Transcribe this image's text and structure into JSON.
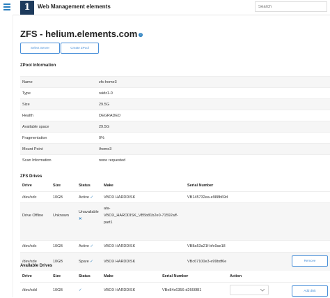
{
  "header": {
    "brand": "Web Management elements",
    "search_placeholder": "Search"
  },
  "page": {
    "title": "ZFS - helium.elements.com"
  },
  "buttons": {
    "select_server": "Select Server",
    "create_zpool": "Create ZPool"
  },
  "zpool_info": {
    "heading": "ZPool Information",
    "rows": [
      {
        "key": "Name",
        "value": "zfs-home3"
      },
      {
        "key": "Type",
        "value": "raidz1-0"
      },
      {
        "key": "Size",
        "value": "29.5G"
      },
      {
        "key": "Health",
        "value": "DEGRADED"
      },
      {
        "key": "Available space",
        "value": "29.5G"
      },
      {
        "key": "Fragmentation",
        "value": "0%"
      },
      {
        "key": "Mount Point",
        "value": "/home3"
      },
      {
        "key": "Scan Information",
        "value": "none requested"
      }
    ]
  },
  "zfs_drives": {
    "heading": "ZFS Drives",
    "headers": {
      "drive": "Drive",
      "size": "Size",
      "status": "Status",
      "make": "Make",
      "serial": "Serial Number"
    },
    "rows": [
      {
        "drive": "/dev/sdc",
        "size": "10GB",
        "status": "Active",
        "status_mark": "✓",
        "make": "VBOX HARDDISK",
        "serial": "VB145732ea-e988b69d"
      },
      {
        "drive": "Drive Offline",
        "size": "Unknown",
        "status": "Unavailable",
        "status_mark": "✕",
        "make_1": "ata-",
        "make_2": "VBOX_HARDDISK_VB5b81b2e0-71592aff-",
        "make_3": "part1",
        "serial": ""
      },
      {
        "drive": "/dev/sdc",
        "size": "10GB",
        "status": "Active",
        "status_mark": "✓",
        "make": "VBOX HARDDISK",
        "serial": "VB8a53a21f-bfc9ae18"
      },
      {
        "drive": "/dev/sde",
        "size": "10GB",
        "status": "Spare",
        "status_mark": "✓",
        "make": "VBOX HARDDISK",
        "serial": "VBc67100e3-e99bdf6e",
        "action": "Remove"
      }
    ]
  },
  "available_drives": {
    "heading": "Available Drives",
    "headers": {
      "drive": "Drive",
      "size": "Size",
      "status": "Status",
      "make": "Make",
      "serial": "Serial Number",
      "action": "Action"
    },
    "rows": [
      {
        "drive": "/dev/sdd",
        "size": "10GB",
        "status_mark": "✓",
        "make": "VBOX HARDDISK",
        "serial": "VBe84c6356-d2666f81",
        "action": "Add disk"
      }
    ]
  }
}
